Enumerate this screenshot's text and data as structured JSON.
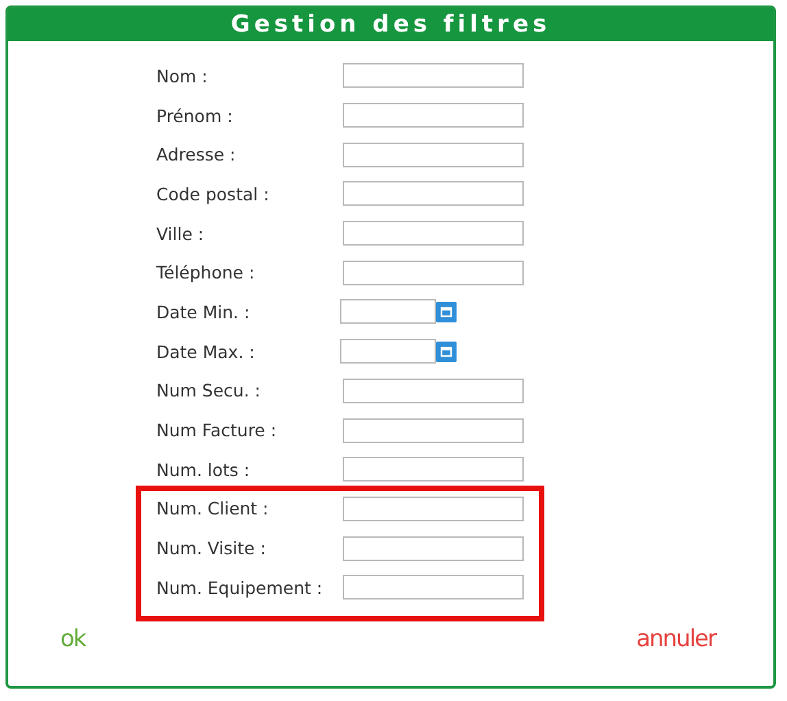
{
  "window": {
    "title": "Gestion des filtres"
  },
  "fields": [
    {
      "label": "Nom :",
      "kind": "text",
      "highlighted": false
    },
    {
      "label": "Prénom :",
      "kind": "text",
      "highlighted": false
    },
    {
      "label": "Adresse :",
      "kind": "text",
      "highlighted": false
    },
    {
      "label": "Code postal :",
      "kind": "text",
      "highlighted": false
    },
    {
      "label": "Ville :",
      "kind": "text",
      "highlighted": false
    },
    {
      "label": "Téléphone :",
      "kind": "text",
      "highlighted": false
    },
    {
      "label": "Date Min. :",
      "kind": "date",
      "highlighted": false
    },
    {
      "label": "Date Max. :",
      "kind": "date",
      "highlighted": false
    },
    {
      "label": "Num Secu. :",
      "kind": "text",
      "highlighted": false
    },
    {
      "label": "Num Facture :",
      "kind": "text",
      "highlighted": false
    },
    {
      "label": "Num. lots :",
      "kind": "text",
      "highlighted": false
    },
    {
      "label": "Num. Client :",
      "kind": "text",
      "highlighted": true
    },
    {
      "label": "Num. Visite :",
      "kind": "text",
      "highlighted": true
    },
    {
      "label": "Num. Equipement :",
      "kind": "text",
      "highlighted": true
    }
  ],
  "buttons": {
    "ok": "ok",
    "cancel": "annuler"
  }
}
